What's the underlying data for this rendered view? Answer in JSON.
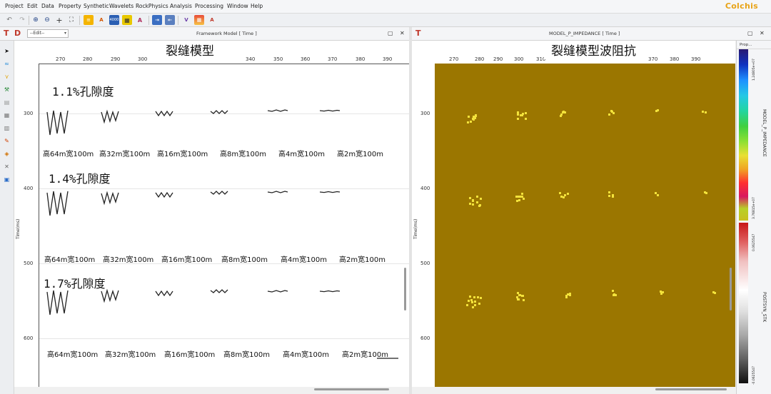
{
  "menu": [
    "Project",
    "Edit",
    "Data",
    "Property",
    "Synthetic",
    "Wavelets",
    "RockPhysics",
    "Analysis",
    "Processing",
    "Window",
    "Help"
  ],
  "brand": "Colchis",
  "toolbar": {
    "icon_label": "4000"
  },
  "left_panel": {
    "select_value": "--Edit--",
    "title": "Framework Model [ Time ]",
    "overlay_title": "裂缝模型",
    "y_axis_label": "Time(ms)",
    "x_ticks": [
      "270",
      "280",
      "290",
      "300",
      "340",
      "350",
      "360",
      "370",
      "380",
      "390"
    ],
    "y_ticks": [
      "300",
      "400",
      "500",
      "600"
    ],
    "porosity_labels": [
      "1.1%孔隙度",
      "1.4%孔隙度",
      "1.7%孔隙度"
    ],
    "fracture_labels": [
      "高64m宽100m",
      "高32m宽100m",
      "高16m宽100m",
      "高8m宽100m",
      "高4m宽100m",
      "高2m宽100m"
    ]
  },
  "right_panel": {
    "title": "MODEL_P_IMPEDANCE [ Time ]",
    "overlay_title": "裂缝模型波阻抗",
    "y_axis_label": "Time(ms)",
    "x_ticks": [
      "270",
      "280",
      "290",
      "300",
      "310",
      "370",
      "380",
      "390"
    ],
    "y_ticks": [
      "300",
      "400",
      "500",
      "600"
    ],
    "field_color": "#9b7600",
    "dot_color": "#f3e23a"
  },
  "colorbar": {
    "header": "Prop...",
    "impedance_label": "MODEL_P_IMPEDANCE",
    "impedance_max": "1.24805e+07",
    "impedance_min": "3.76815e+07",
    "stack_label": "POSTSYN_STK",
    "stack_max": "0.0625547",
    "stack_min": "-0.0625547"
  }
}
